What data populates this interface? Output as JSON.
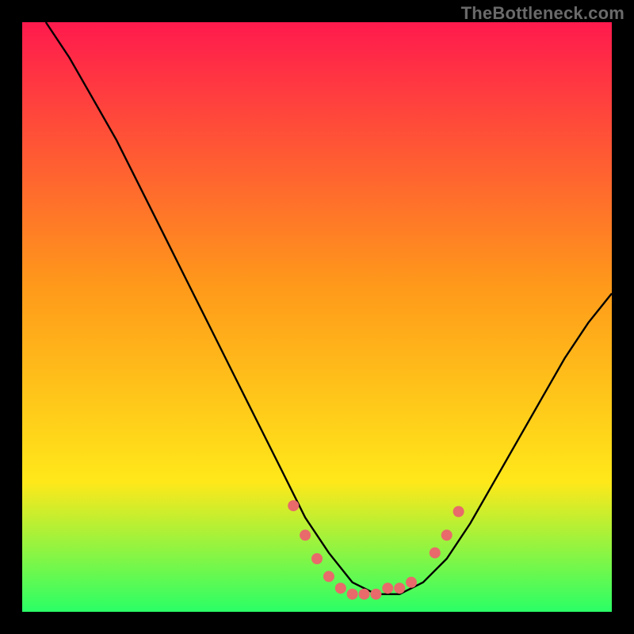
{
  "watermark": "TheBottleneck.com",
  "chart_data": {
    "type": "line",
    "title": "",
    "xlabel": "",
    "ylabel": "",
    "xlim": [
      0,
      100
    ],
    "ylim": [
      0,
      100
    ],
    "grid": false,
    "legend": false,
    "series": [
      {
        "name": "bottleneck-curve",
        "x": [
          4,
          8,
          12,
          16,
          20,
          24,
          28,
          32,
          36,
          40,
          44,
          48,
          52,
          56,
          60,
          64,
          68,
          72,
          76,
          80,
          84,
          88,
          92,
          96,
          100
        ],
        "y": [
          100,
          94,
          87,
          80,
          72,
          64,
          56,
          48,
          40,
          32,
          24,
          16,
          10,
          5,
          3,
          3,
          5,
          9,
          15,
          22,
          29,
          36,
          43,
          49,
          54
        ]
      }
    ],
    "highlight_points": {
      "name": "marker-cluster",
      "color": "#e86a6a",
      "x": [
        46,
        48,
        50,
        52,
        54,
        56,
        58,
        60,
        62,
        64,
        66,
        70,
        72,
        74
      ],
      "y": [
        18,
        13,
        9,
        6,
        4,
        3,
        3,
        3,
        4,
        4,
        5,
        10,
        13,
        17
      ]
    },
    "background_gradient": {
      "top": "#ff1a4d",
      "mid1": "#ff9a1a",
      "mid2": "#ffe81a",
      "bottom": "#2aff66"
    }
  }
}
